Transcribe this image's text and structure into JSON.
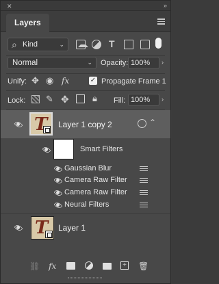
{
  "panel": {
    "title_tab": "Layers",
    "close_glyph": "✕",
    "collapse_glyph": "»"
  },
  "filter": {
    "kind_label": "Kind",
    "search_glyph": "⌕",
    "icons": [
      "image-filter-icon",
      "adjustment-filter-icon",
      "type-filter-icon",
      "shape-filter-icon",
      "smart-object-filter-icon",
      "filter-toggle-icon"
    ],
    "type_glyph": "T"
  },
  "blend": {
    "mode": "Normal",
    "opacity_label": "Opacity:",
    "opacity_value": "100%"
  },
  "unify": {
    "label": "Unify:",
    "fx_glyph": "fx",
    "propagate_label": "Propagate Frame 1",
    "propagate_checked": true
  },
  "lock": {
    "label": "Lock:",
    "fill_label": "Fill:",
    "fill_value": "100%"
  },
  "layers": [
    {
      "name": "Layer 1 copy 2",
      "selected": true,
      "visible": true
    },
    {
      "name": "Smart Filters",
      "visible": true
    },
    {
      "name": "Gaussian Blur",
      "visible": true
    },
    {
      "name": "Camera Raw Filter",
      "visible": true
    },
    {
      "name": "Camera Raw Filter",
      "visible": true
    },
    {
      "name": "Neural Filters",
      "visible": true
    },
    {
      "name": "Layer 1",
      "visible": true
    }
  ],
  "bottom": {
    "fx_glyph": "fx"
  },
  "colors": {
    "panel_bg": "#484848",
    "selected_row": "#5e5e5e",
    "text": "#e6e6e6"
  }
}
